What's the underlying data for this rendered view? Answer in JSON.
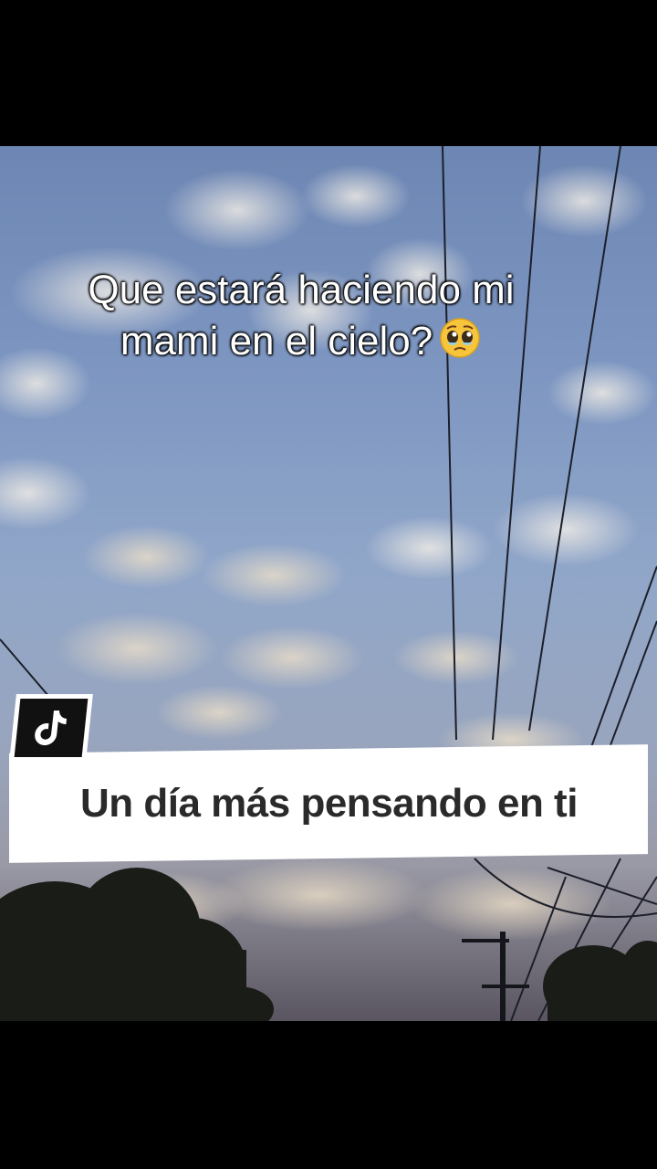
{
  "caption": {
    "line1": "Que estará haciendo mi",
    "line2": "mami en el cielo?",
    "emoji": "pleading-face-with-tears"
  },
  "banner": {
    "text": "Un día más pensando en ti"
  },
  "badge": {
    "icon": "tiktok-logo-icon"
  },
  "colors": {
    "sky": "#7d96c1",
    "banner_bg": "#ffffff",
    "banner_text": "#2a2a2a",
    "caption_text": "#ffffff"
  }
}
